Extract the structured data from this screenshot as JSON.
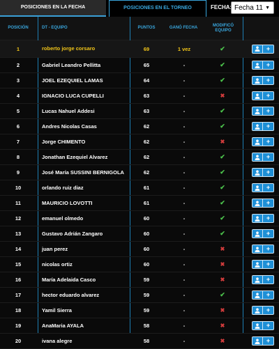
{
  "tabs": [
    "POSICIONES EN LA FECHA",
    "POSICIONES EN EL TORNEO"
  ],
  "fecha": {
    "label": "FECHA:",
    "selected": "Fecha 11"
  },
  "columns": {
    "pos": "POSICIÓN",
    "name": "DT - EQUIPO",
    "pts": "PUNTOS",
    "gano": "GANÓ FECHA",
    "mod": "MODIFICÓ EQUIPO"
  },
  "colors": {
    "accent": "#39a6dd",
    "highlight": "#f0c419",
    "check": "#4cc34c",
    "cross": "#d23c3c"
  },
  "rows": [
    {
      "pos": "1",
      "name": "roberto jorge corsaro",
      "pts": "69",
      "gano": "1 vez",
      "mod": "check"
    },
    {
      "pos": "2",
      "name": "Gabriel Leandro Pellitta",
      "pts": "65",
      "gano": "-",
      "mod": "check"
    },
    {
      "pos": "3",
      "name": "JOEL EZEQUIEL LAMAS",
      "pts": "64",
      "gano": "-",
      "mod": "check"
    },
    {
      "pos": "4",
      "name": "IGNACIO LUCA CUPELLI",
      "pts": "63",
      "gano": "-",
      "mod": "cross"
    },
    {
      "pos": "5",
      "name": "Lucas Nahuel Addesi",
      "pts": "63",
      "gano": "-",
      "mod": "check"
    },
    {
      "pos": "6",
      "name": "Andres Nicolas Casas",
      "pts": "62",
      "gano": "-",
      "mod": "check"
    },
    {
      "pos": "7",
      "name": "Jorge CHIMENTO",
      "pts": "62",
      "gano": "-",
      "mod": "cross"
    },
    {
      "pos": "8",
      "name": "Jonathan Ezequiel Alvarez",
      "pts": "62",
      "gano": "-",
      "mod": "check"
    },
    {
      "pos": "9",
      "name": "José María SUSSINI BERNIGOLA",
      "pts": "62",
      "gano": "-",
      "mod": "check"
    },
    {
      "pos": "10",
      "name": "orlando ruiz diaz",
      "pts": "61",
      "gano": "-",
      "mod": "check"
    },
    {
      "pos": "11",
      "name": "MAURICIO LOVOTTI",
      "pts": "61",
      "gano": "-",
      "mod": "check"
    },
    {
      "pos": "12",
      "name": "emanuel olmedo",
      "pts": "60",
      "gano": "-",
      "mod": "check"
    },
    {
      "pos": "13",
      "name": "Gustavo Adrián Zangaro",
      "pts": "60",
      "gano": "-",
      "mod": "check"
    },
    {
      "pos": "14",
      "name": "juan perez",
      "pts": "60",
      "gano": "-",
      "mod": "cross"
    },
    {
      "pos": "15",
      "name": "nicolas ortiz",
      "pts": "60",
      "gano": "-",
      "mod": "cross"
    },
    {
      "pos": "16",
      "name": "María Adelaida Casco",
      "pts": "59",
      "gano": "-",
      "mod": "cross"
    },
    {
      "pos": "17",
      "name": "hector eduardo alvarez",
      "pts": "59",
      "gano": "-",
      "mod": "check"
    },
    {
      "pos": "18",
      "name": "Yamil Sierra",
      "pts": "59",
      "gano": "-",
      "mod": "cross"
    },
    {
      "pos": "19",
      "name": "AnaMaria AYALA",
      "pts": "58",
      "gano": "-",
      "mod": "cross"
    },
    {
      "pos": "20",
      "name": "ivana alegre",
      "pts": "58",
      "gano": "-",
      "mod": "cross"
    }
  ]
}
